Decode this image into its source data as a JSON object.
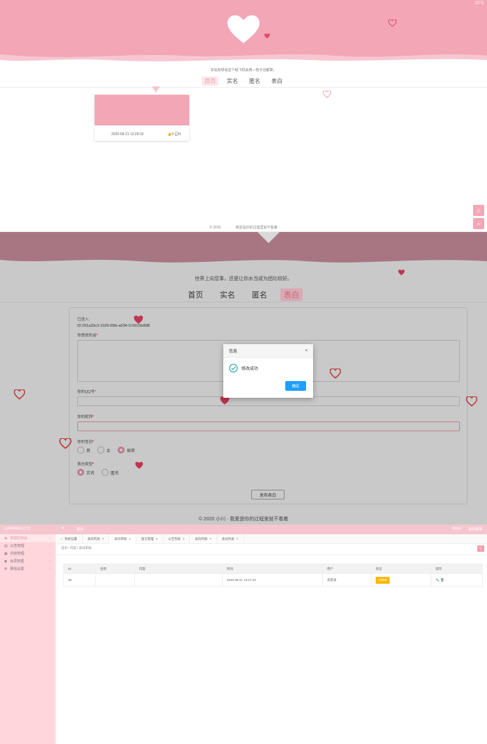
{
  "front": {
    "top_right": "22°C",
    "motto": "本站有想说这个纸飞机会用—管子也都算。",
    "nav": [
      "首页",
      "实名",
      "匿名",
      "表白"
    ],
    "nav_active": "首页",
    "card": {
      "date": "2020-08-21 13:28:33",
      "likes": "0",
      "comments": "0"
    },
    "footer": [
      "© 2020",
      "我爱是你的过程里就不看着"
    ],
    "side_buttons": [
      "home-icon",
      "search-icon"
    ],
    "colors": {
      "pink": "#f2a6b6",
      "light_pink": "#fde6ea"
    }
  },
  "form_page": {
    "motto": "世界上向您事，还是让你水当成为团比较好。",
    "nav": [
      "首页",
      "实名",
      "匿名",
      "表白"
    ],
    "nav_active": "表白",
    "publisher_label": "已进入:",
    "publisher_value": "ID:291a33c3-1529-09fe-a034-0.09155d0f8",
    "fields": [
      {
        "label": "你想说的话"
      },
      {
        "label": "你的QQ号"
      },
      {
        "label": "你的昵称"
      }
    ],
    "gender": {
      "label": "你的性别",
      "options": [
        "男",
        "女",
        "保密"
      ],
      "selected": "保密"
    },
    "visibility": {
      "label": "表白类型",
      "options": [
        "实名",
        "匿名"
      ],
      "selected": "实名"
    },
    "submit": "发布表白",
    "footer": "© 2020 小川 · 我爱是你的过程里就不看着",
    "dialog": {
      "title": "信息",
      "message": "修改成功",
      "confirm": "确定",
      "close": "×"
    }
  },
  "admin": {
    "brand": "LOVEWALL(2.0)",
    "home": "首页",
    "user": "Admin",
    "logout": "退出登录",
    "sidebar": [
      {
        "label": "数据控制台",
        "icon": "dashboard-icon"
      },
      {
        "label": "公告管理",
        "icon": "notice-icon"
      },
      {
        "label": "内容管理",
        "icon": "content-icon"
      },
      {
        "label": "会员管理",
        "icon": "user-icon"
      },
      {
        "label": "网站设置",
        "icon": "gear-icon"
      }
    ],
    "tabs": [
      "系统设置",
      "表白列表",
      "表白审核",
      "留言管理",
      "公告列表",
      "表白列表",
      "会员列表"
    ],
    "tab_active": "表白审核",
    "breadcrumb": "首页 / 内容 / 表白审核",
    "table": {
      "headers": [
        "ID",
        "名称",
        "内容",
        "时间",
        "用户",
        "状态",
        "操作"
      ],
      "rows": [
        {
          "id": "96",
          "name": "",
          "content": "",
          "time": "2020-08-21 13:27:33",
          "user": "未登录",
          "status": "未审核",
          "ops": "🔍 🗑"
        }
      ]
    },
    "colors": {
      "topbar": "#f6c6cf",
      "sidebar": "#ffd6dc",
      "badge": "#ffb800"
    }
  }
}
